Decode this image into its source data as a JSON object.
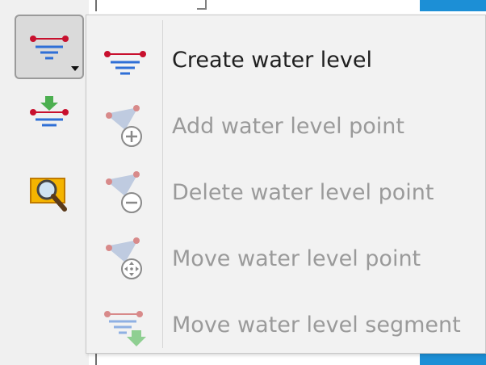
{
  "toolbar": {
    "buttons": [
      {
        "name": "create-water-level-tool",
        "icon": "water-level-line-icon",
        "has_dropdown": true,
        "pressed": true
      },
      {
        "name": "water-level-import-tool",
        "icon": "water-level-arrow-down-icon",
        "has_dropdown": false,
        "pressed": false
      },
      {
        "name": "zoom-tool",
        "icon": "magnifier-icon",
        "has_dropdown": false,
        "pressed": false
      }
    ]
  },
  "menu": {
    "items": [
      {
        "label": "Create water level",
        "icon": "water-level-line-icon",
        "enabled": true
      },
      {
        "label": "Add water level point",
        "icon": "add-point-icon",
        "enabled": false
      },
      {
        "label": "Delete water level point",
        "icon": "delete-point-icon",
        "enabled": false
      },
      {
        "label": "Move water level point",
        "icon": "move-point-icon",
        "enabled": false
      },
      {
        "label": "Move water level segment",
        "icon": "move-segment-icon",
        "enabled": false
      }
    ]
  },
  "colors": {
    "marker_red": "#c8102e",
    "line_blue": "#2f6fd6",
    "arrow_green": "#4caf50",
    "disabled_text": "#9a9a9a",
    "enabled_text": "#202020",
    "accent_blue": "#1c8fd6"
  }
}
